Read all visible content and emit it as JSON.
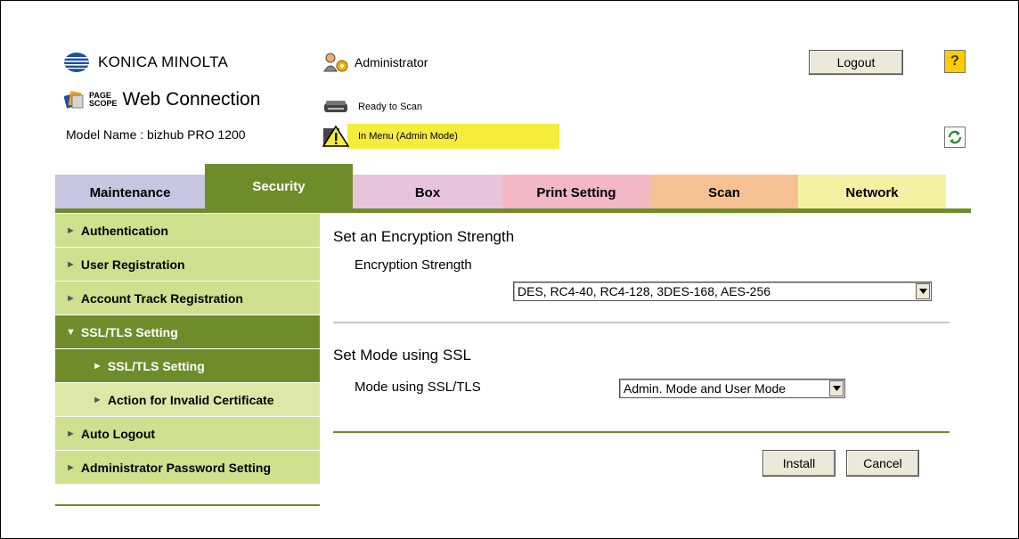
{
  "header": {
    "brand": "KONICA MINOLTA",
    "product_prefix_line1": "PAGE",
    "product_prefix_line2": "SCOPE",
    "product": "Web Connection",
    "model_name": "Model Name : bizhub PRO 1200",
    "user": "Administrator",
    "status_scan": "Ready to Scan",
    "status_mode": "In Menu (Admin Mode)",
    "logout_label": "Logout",
    "help_label": "?"
  },
  "tabs": [
    {
      "label": "Maintenance",
      "bg": "#c8c6e2",
      "color": "#000000",
      "active": false
    },
    {
      "label": "Security",
      "bg": "#6e8d2a",
      "color": "#ffffff",
      "active": true
    },
    {
      "label": "Box",
      "bg": "#e8c4dc",
      "color": "#000000",
      "active": false
    },
    {
      "label": "Print Setting",
      "bg": "#f3b7c6",
      "color": "#000000",
      "active": false
    },
    {
      "label": "Scan",
      "bg": "#f6c193",
      "color": "#000000",
      "active": false
    },
    {
      "label": "Network",
      "bg": "#f6f0a2",
      "color": "#000000",
      "active": false
    }
  ],
  "sidebar": {
    "items": [
      {
        "label": "Authentication",
        "arrow": "►",
        "style": "top"
      },
      {
        "label": "User Registration",
        "arrow": "►",
        "style": "top"
      },
      {
        "label": "Account Track Registration",
        "arrow": "►",
        "style": "top"
      },
      {
        "label": "SSL/TLS Setting",
        "arrow": "▼",
        "style": "open"
      },
      {
        "label": "SSL/TLS Setting",
        "arrow": "►",
        "style": "sub-active"
      },
      {
        "label": "Action for Invalid Certificate",
        "arrow": "►",
        "style": "sub"
      },
      {
        "label": "Auto Logout",
        "arrow": "►",
        "style": "top"
      },
      {
        "label": "Administrator Password Setting",
        "arrow": "►",
        "style": "top"
      }
    ]
  },
  "main": {
    "section1_title": "Set an Encryption Strength",
    "encryption_label": "Encryption Strength",
    "encryption_value": "DES, RC4-40, RC4-128, 3DES-168, AES-256",
    "section2_title": "Set Mode using SSL",
    "mode_label": "Mode using SSL/TLS",
    "mode_value": "Admin. Mode and User Mode",
    "install_label": "Install",
    "cancel_label": "Cancel"
  },
  "colors": {
    "accent_green": "#6e8d2a",
    "sidebar_light": "#cfe08f",
    "sidebar_sub": "#dde8a6",
    "status_highlight": "#f5ec3c"
  }
}
